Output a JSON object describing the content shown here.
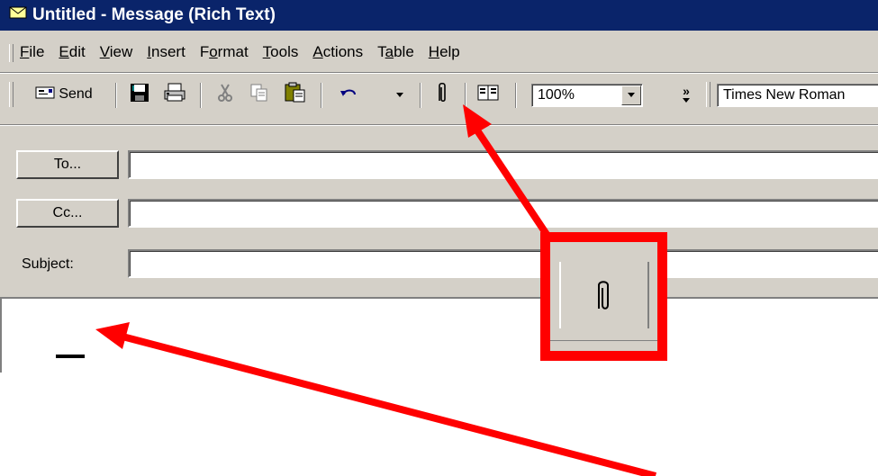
{
  "window": {
    "title": "Untitled - Message (Rich Text)",
    "icon": "envelope-icon"
  },
  "menu": [
    {
      "label": "File"
    },
    {
      "label": "Edit"
    },
    {
      "label": "View"
    },
    {
      "label": "Insert"
    },
    {
      "label": "Format"
    },
    {
      "label": "Tools"
    },
    {
      "label": "Actions"
    },
    {
      "label": "Table"
    },
    {
      "label": "Help"
    }
  ],
  "toolbar": {
    "send_label": "Send",
    "zoom_value": "100%",
    "font_value": "Times New Roman",
    "more_label": "»",
    "icons": [
      "send-icon",
      "save-icon",
      "print-icon",
      "cut-icon",
      "copy-icon",
      "paste-icon",
      "undo-icon",
      "attach-icon",
      "address-book-icon"
    ]
  },
  "header": {
    "to_label": "To...",
    "cc_label": "Cc...",
    "subject_label": "Subject:",
    "to_value": "",
    "cc_value": "",
    "subject_value": ""
  },
  "annotations": {
    "highlight_color": "#ff0000"
  }
}
